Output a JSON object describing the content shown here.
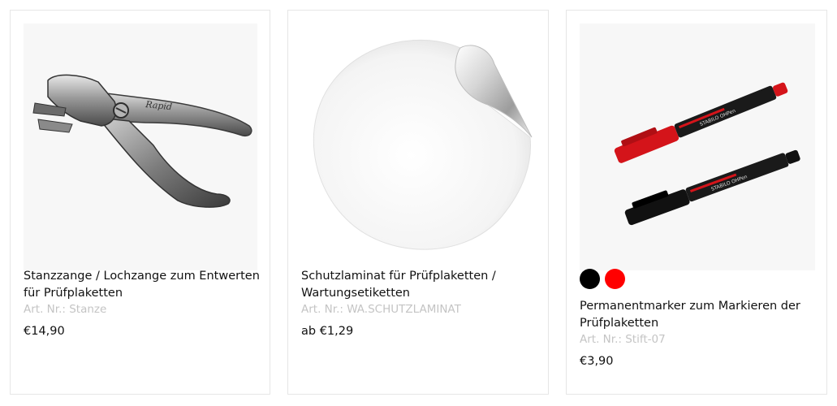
{
  "products": [
    {
      "title": "Stanzzange / Lochzange zum Entwerten für Prüfplaketten",
      "sku": "Art. Nr.: Stanze",
      "price": "€14,90",
      "image_icon": "hole-punch-pliers-icon"
    },
    {
      "title": "Schutzlaminat für Prüfplaketten / Wartungsetiketten",
      "sku": "Art. Nr.: WA.SCHUTZLAMINAT",
      "price": "ab €1,29",
      "image_icon": "protective-laminate-sticker-icon"
    },
    {
      "title": "Permanentmarker zum Markieren der Prüfplaketten",
      "sku": "Art. Nr.: Stift-07",
      "price": "€3,90",
      "image_icon": "permanent-marker-pens-icon",
      "swatches": [
        {
          "name": "black",
          "color": "#000000"
        },
        {
          "name": "red",
          "color": "#ff0000"
        }
      ]
    }
  ]
}
